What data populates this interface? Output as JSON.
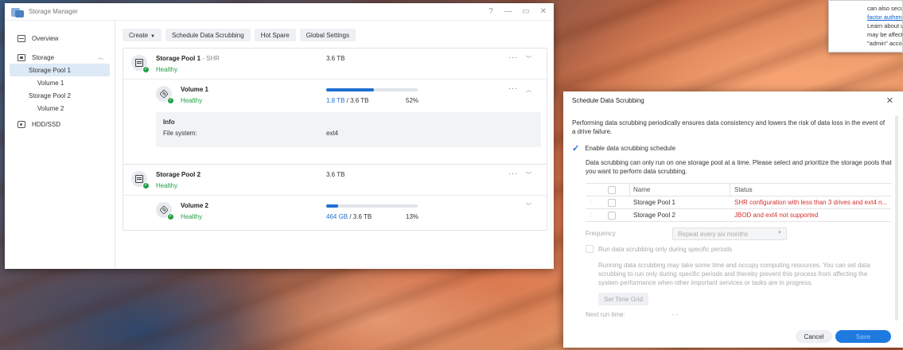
{
  "help_popup": {
    "lines": [
      "can also secu",
      "factor authenti",
      "Learn about w",
      "may be affecte",
      "\"admin\" accou"
    ]
  },
  "storage_manager": {
    "title": "Storage Manager",
    "controls": [
      "?",
      "—",
      "▭",
      "✕"
    ],
    "sidebar": {
      "overview": "Overview",
      "storage": "Storage",
      "storage_pool_1": "Storage Pool 1",
      "volume_1": "Volume 1",
      "storage_pool_2": "Storage Pool 2",
      "volume_2": "Volume 2",
      "hdd": "HDD/SSD"
    },
    "toolbar": {
      "create": "Create",
      "schedule": "Schedule Data Scrubbing",
      "hot_spare": "Hot Spare",
      "global_settings": "Global Settings"
    },
    "pools": [
      {
        "name": "Storage Pool 1",
        "raid": " - SHR",
        "status": "Healthy",
        "size": "3.6 TB",
        "volume": {
          "name": "Volume 1",
          "status": "Healthy",
          "used": "1.8 TB",
          "total": " / 3.6 TB",
          "percent_text": "52%",
          "percent": 52,
          "info_title": "Info",
          "fs_label": "File system:",
          "fs_value": "ext4"
        }
      },
      {
        "name": "Storage Pool 2",
        "status": "Healthy",
        "size": "3.6 TB",
        "volume": {
          "name": "Volume 2",
          "status": "Healthy",
          "used": "464 GB",
          "total": " / 3.6 TB",
          "percent_text": "13%",
          "percent": 13
        }
      }
    ]
  },
  "dialog": {
    "title": "Schedule Data Scrubbing",
    "description": "Performing data scrubbing periodically ensures data consistency and lowers the risk of data loss in the event of a drive failure.",
    "enable_label": "Enable data scrubbing schedule",
    "pool_desc": "Data scrubbing can only run on one storage pool at a time. Please select and prioritize the storage pools that you want to perform data scrubbing.",
    "table": {
      "col_name": "Name",
      "col_status": "Status",
      "rows": [
        {
          "name": "Storage Pool 1",
          "status": "SHR configuration with less than 3 drives and ext4 n..."
        },
        {
          "name": "Storage Pool 2",
          "status": "JBOD and ext4 not supported"
        }
      ]
    },
    "frequency_label": "Frequency",
    "frequency_value": "Repeat every six months",
    "run_specific_label": "Run data scrubbing only during specific periods",
    "run_specific_desc": "Running data scrubbing may take some time and occupy computing resources. You can set data scrubbing to run only during specific periods and thereby prevent this process from affecting the system performance when other important services or tasks are in progress.",
    "set_time_grid": "Set Time Grid",
    "next_run_label": "Next run time:",
    "next_run_value": "- -",
    "cancel": "Cancel",
    "save": "Save"
  },
  "colors": {
    "accent": "#1f7ae0",
    "healthy": "#23a046",
    "error": "#d0312d"
  }
}
